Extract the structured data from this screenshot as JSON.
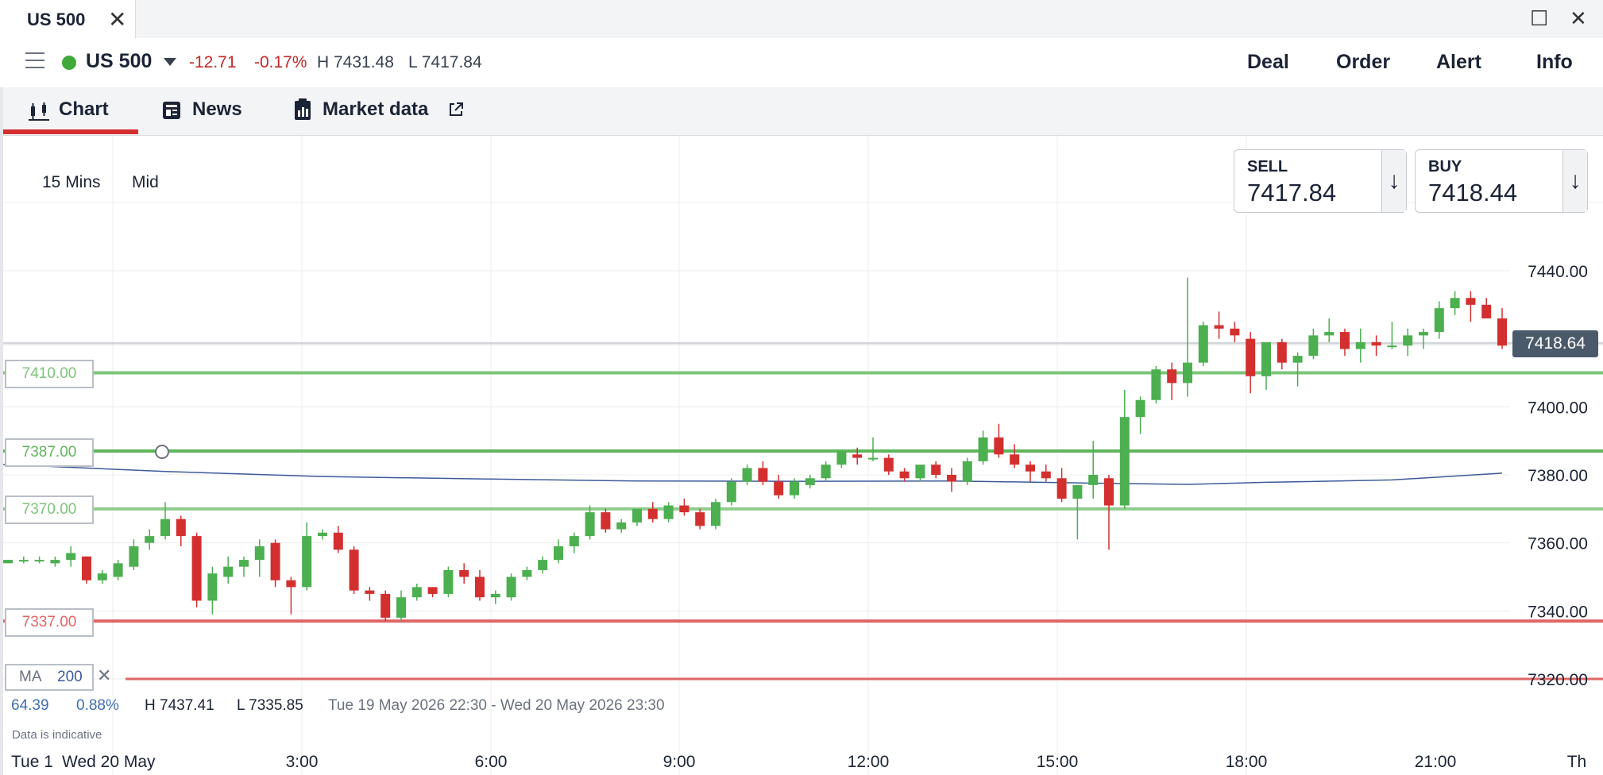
{
  "window": {
    "tab_title": "US 500",
    "tab_close": "✕",
    "maximize": "☐",
    "close": "✕"
  },
  "toolbar": {
    "menu_icon": "hamburger-icon",
    "instrument": "US 500",
    "status_color": "#3faa3a",
    "change": "-12.71",
    "change_pct": "-0.17%",
    "high": "H 7431.48",
    "low": "L 7417.84",
    "actions": [
      "Deal",
      "Order",
      "Alert",
      "Info"
    ]
  },
  "subnav": {
    "tabs": [
      {
        "label": "Chart",
        "icon": "candlestick-icon",
        "active": true
      },
      {
        "label": "News",
        "icon": "newspaper-icon",
        "active": false
      },
      {
        "label": "Market data",
        "icon": "market-data-icon",
        "active": false
      }
    ],
    "external_icon": "external-link-icon"
  },
  "chart_options": {
    "interval": "15 Mins",
    "price_type": "Mid"
  },
  "quotes": {
    "sell_label": "SELL",
    "sell_value": "7417.84",
    "buy_label": "BUY",
    "buy_value": "7418.44",
    "arrow": "↓"
  },
  "current_price": "7418.64",
  "levels": [
    {
      "label": "7410.00",
      "value": 7410,
      "color": "#7cc47a"
    },
    {
      "label": "7387.00",
      "value": 7387,
      "color": "#5fb65c"
    },
    {
      "label": "7370.00",
      "value": 7370,
      "color": "#8fcc8c"
    },
    {
      "label": "7337.00",
      "value": 7337,
      "color": "#e06666"
    }
  ],
  "ma": {
    "label": "MA",
    "period": "200",
    "remove": "✕"
  },
  "info_row": {
    "v1": "64.39",
    "v2": "0.88%",
    "high": "H 7437.41",
    "low": "L 7335.85",
    "range": "Tue 19 May 2026 22:30 - Wed 20 May 2026 23:30"
  },
  "disclaimer": "Data is indicative",
  "colors": {
    "up": "#4caf50",
    "down": "#d32f2f",
    "ma_line": "#3c5a99",
    "brand_red": "#d32f2f"
  },
  "chart_data": {
    "type": "candlestick",
    "interval_minutes": 15,
    "x_axis_labels": [
      "Tue 1",
      "Wed 20 May",
      "3:00",
      "6:00",
      "9:00",
      "12:00",
      "15:00",
      "18:00",
      "21:00",
      "Th"
    ],
    "y_ticks": [
      7440,
      7400,
      7380,
      7360,
      7340,
      7320
    ],
    "y_tick_labels": [
      "7440.00",
      "7400.00",
      "7380.00",
      "7360.00",
      "7340.00",
      "7320.00"
    ],
    "ylim": [
      7313,
      7448
    ],
    "horizontal_levels": [
      7410,
      7387,
      7370,
      7337
    ],
    "candles_ohlc": [
      [
        7354,
        7355,
        7354,
        7355
      ],
      [
        7355,
        7356,
        7354,
        7355
      ],
      [
        7355,
        7356,
        7354,
        7355
      ],
      [
        7354,
        7356,
        7353,
        7355
      ],
      [
        7355,
        7359,
        7353,
        7357
      ],
      [
        7356,
        7356,
        7348,
        7349
      ],
      [
        7349,
        7352,
        7348,
        7351
      ],
      [
        7350,
        7355,
        7349,
        7354
      ],
      [
        7353,
        7361,
        7352,
        7359
      ],
      [
        7360,
        7364,
        7358,
        7362
      ],
      [
        7362,
        7372,
        7361,
        7367
      ],
      [
        7367,
        7368,
        7359,
        7362
      ],
      [
        7362,
        7363,
        7341,
        7343
      ],
      [
        7343,
        7353,
        7339,
        7351
      ],
      [
        7350,
        7356,
        7348,
        7353
      ],
      [
        7353,
        7356,
        7350,
        7355
      ],
      [
        7355,
        7361,
        7350,
        7359
      ],
      [
        7360,
        7361,
        7347,
        7349
      ],
      [
        7349,
        7350,
        7339,
        7347
      ],
      [
        7347,
        7366,
        7346,
        7362
      ],
      [
        7362,
        7364,
        7361,
        7363
      ],
      [
        7363,
        7365,
        7357,
        7358
      ],
      [
        7358,
        7359,
        7345,
        7346
      ],
      [
        7346,
        7347,
        7343,
        7345
      ],
      [
        7345,
        7346,
        7337,
        7338
      ],
      [
        7338,
        7346,
        7337,
        7344
      ],
      [
        7344,
        7348,
        7343,
        7347
      ],
      [
        7347,
        7347,
        7344,
        7345
      ],
      [
        7345,
        7353,
        7344,
        7352
      ],
      [
        7352,
        7354,
        7348,
        7350
      ],
      [
        7350,
        7352,
        7343,
        7344
      ],
      [
        7344,
        7346,
        7342,
        7345
      ],
      [
        7344,
        7351,
        7343,
        7350
      ],
      [
        7350,
        7353,
        7349,
        7352
      ],
      [
        7352,
        7356,
        7351,
        7355
      ],
      [
        7355,
        7361,
        7354,
        7359
      ],
      [
        7359,
        7363,
        7357,
        7362
      ],
      [
        7362,
        7371,
        7361,
        7369
      ],
      [
        7369,
        7370,
        7363,
        7364
      ],
      [
        7364,
        7367,
        7363,
        7366
      ],
      [
        7366,
        7369,
        7365,
        7370
      ],
      [
        7370,
        7372,
        7366,
        7367
      ],
      [
        7367,
        7372,
        7366,
        7371
      ],
      [
        7371,
        7373,
        7368,
        7369
      ],
      [
        7369,
        7370,
        7364,
        7365
      ],
      [
        7365,
        7373,
        7364,
        7372
      ],
      [
        7372,
        7379,
        7371,
        7378
      ],
      [
        7378,
        7383,
        7377,
        7382
      ],
      [
        7382,
        7384,
        7377,
        7378
      ],
      [
        7378,
        7380,
        7373,
        7374
      ],
      [
        7374,
        7379,
        7373,
        7378
      ],
      [
        7377,
        7380,
        7376,
        7379
      ],
      [
        7379,
        7384,
        7378,
        7383
      ],
      [
        7383,
        7387,
        7382,
        7387
      ],
      [
        7386,
        7388,
        7383,
        7385
      ],
      [
        7385,
        7391,
        7384,
        7385
      ],
      [
        7385,
        7386,
        7380,
        7381
      ],
      [
        7381,
        7382,
        7378,
        7379
      ],
      [
        7379,
        7382,
        7378,
        7383
      ],
      [
        7383,
        7384,
        7379,
        7380
      ],
      [
        7380,
        7382,
        7375,
        7378
      ],
      [
        7378,
        7385,
        7377,
        7384
      ],
      [
        7384,
        7393,
        7383,
        7391
      ],
      [
        7391,
        7395,
        7385,
        7386
      ],
      [
        7386,
        7389,
        7382,
        7383
      ],
      [
        7383,
        7384,
        7378,
        7381
      ],
      [
        7381,
        7383,
        7378,
        7379
      ],
      [
        7379,
        7382,
        7372,
        7373
      ],
      [
        7373,
        7374,
        7361,
        7377
      ],
      [
        7377,
        7390,
        7373,
        7380
      ],
      [
        7379,
        7380,
        7358,
        7371
      ],
      [
        7371,
        7405,
        7370,
        7397
      ],
      [
        7397,
        7403,
        7392,
        7402
      ],
      [
        7402,
        7412,
        7401,
        7411
      ],
      [
        7411,
        7413,
        7402,
        7407
      ],
      [
        7407,
        7438,
        7403,
        7413
      ],
      [
        7413,
        7425,
        7412,
        7424
      ],
      [
        7424,
        7428,
        7420,
        7423
      ],
      [
        7423,
        7425,
        7419,
        7421
      ],
      [
        7420,
        7422,
        7404,
        7409
      ],
      [
        7409,
        7412,
        7405,
        7419
      ],
      [
        7419,
        7420,
        7411,
        7413
      ],
      [
        7413,
        7416,
        7406,
        7415
      ],
      [
        7415,
        7423,
        7414,
        7421
      ],
      [
        7421,
        7426,
        7419,
        7422
      ],
      [
        7422,
        7423,
        7415,
        7417
      ],
      [
        7417,
        7423,
        7413,
        7419
      ],
      [
        7419,
        7421,
        7415,
        7418
      ],
      [
        7418,
        7425,
        7417,
        7418
      ],
      [
        7418,
        7423,
        7415,
        7421
      ],
      [
        7421,
        7423,
        7417,
        7422
      ],
      [
        7422,
        7431,
        7420,
        7429
      ],
      [
        7429,
        7434,
        7427,
        7432
      ],
      [
        7432,
        7434,
        7425,
        7430
      ],
      [
        7430,
        7432,
        7426,
        7426
      ],
      [
        7426,
        7429,
        7417,
        7418
      ]
    ],
    "ma200": {
      "name": "MA 200",
      "points": [
        [
          0,
          7383
        ],
        [
          10,
          7381
        ],
        [
          20,
          7379.5
        ],
        [
          30,
          7378.8
        ],
        [
          40,
          7378.2
        ],
        [
          50,
          7378.1
        ],
        [
          60,
          7378.2
        ],
        [
          70,
          7377.5
        ],
        [
          75,
          7377.2
        ],
        [
          80,
          7377.8
        ],
        [
          88,
          7378.5
        ],
        [
          95,
          7380.5
        ]
      ]
    }
  }
}
